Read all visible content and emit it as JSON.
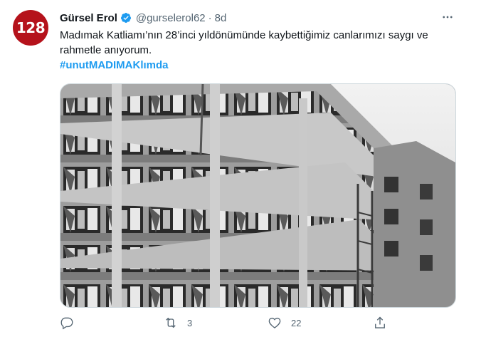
{
  "tweet": {
    "avatar_text": "128",
    "author_name": "Gürsel Erol",
    "handle": "@gurselerol62",
    "separator": "·",
    "time": "8d",
    "body": "Madımak Katliamı’nın 28’inci yıldönümünde kaybettiğimiz canlarımızı saygı ve rahmetle anıyorum.",
    "hashtag": "#unutMADIMAKlımda",
    "media_icon": "photo of damaged building with broken windows"
  },
  "actions": {
    "reply_icon": "reply-icon",
    "retweet_count": "3",
    "like_count": "22",
    "share_icon": "share-icon"
  },
  "colors": {
    "avatar_bg": "#b5121b",
    "hashtag": "#1d9bf0",
    "verified": "#1d9bf0",
    "muted": "#536471"
  }
}
